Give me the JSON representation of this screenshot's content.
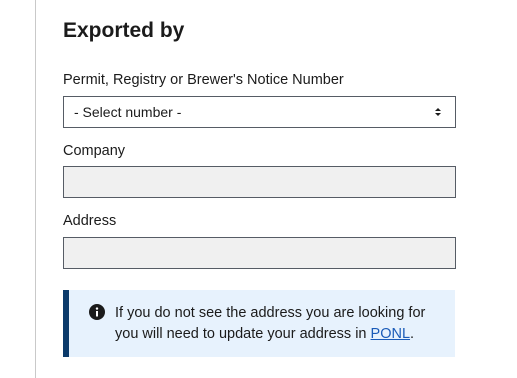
{
  "exported_by": {
    "title": "Exported by",
    "permit_label": "Permit, Registry or Brewer's Notice Number",
    "permit_select_value": "- Select number -",
    "company_label": "Company",
    "company_value": "",
    "address_label": "Address",
    "address_value": ""
  },
  "alert": {
    "icon": "info-icon",
    "text_line1": "If you do not see the address you are looking for",
    "text_line2_prefix": "you will need to update your address in ",
    "link_text": "PONL",
    "text_suffix": "."
  },
  "colors": {
    "alert_background": "#e7f2fd",
    "alert_border": "#0b3a6b",
    "link": "#1a5bb8",
    "input_background": "#f0f0f0"
  }
}
